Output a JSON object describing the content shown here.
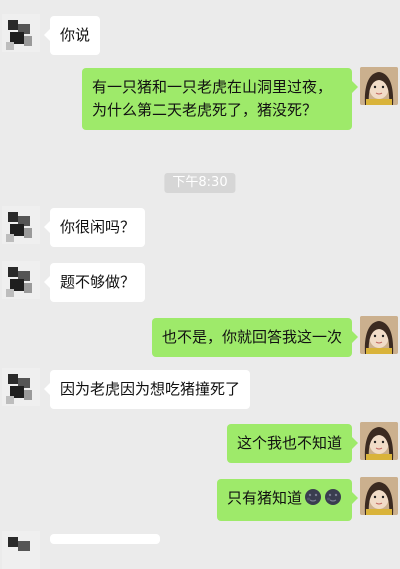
{
  "messages": [
    {
      "side": "left",
      "text": "你说"
    },
    {
      "side": "right",
      "text": "有一只猪和一只老虎在山洞里过夜，为什么第二天老虎死了，猪没死？"
    },
    {
      "side": "left",
      "text": "你很闲吗？"
    },
    {
      "side": "left",
      "text": "题不够做？"
    },
    {
      "side": "right",
      "text": "也不是，你就回答我这一次"
    },
    {
      "side": "left",
      "text": "因为老虎因为想吃猪撞死了"
    },
    {
      "side": "right",
      "text": "这个我也不知道"
    },
    {
      "side": "right",
      "text": "只有猪知道",
      "emoji": [
        "new-moon-face-icon",
        "new-moon-face-icon"
      ]
    }
  ],
  "timestamp": "下午8:30",
  "colors": {
    "background": "#ebebeb",
    "sent_bubble": "#9eea6a",
    "received_bubble": "#ffffff",
    "timestamp_bg": "#d6d6d6"
  }
}
